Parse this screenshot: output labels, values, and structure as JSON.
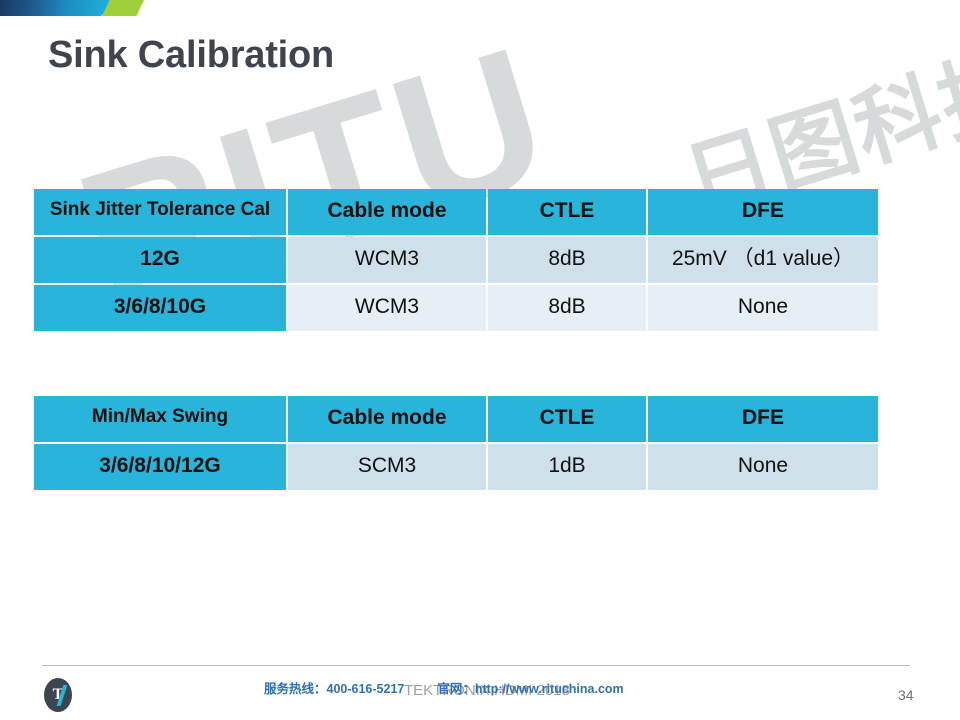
{
  "slide": {
    "title": "Sink Calibration",
    "page_number": "34"
  },
  "banner": {
    "blue_gradient_start": "#173a63",
    "blue_gradient_end": "#22b3df",
    "green_accent": "#9ece3a"
  },
  "watermark": {
    "latin": "RITU",
    "chinese": "日图科技",
    "color": "#c9ccce"
  },
  "colors": {
    "header_cyan": "#29b4d9",
    "cell_blue": "#cfe0ea",
    "cell_light": "#e6eff5",
    "title_gray": "#40454d",
    "footer_blue": "#2f6fb5"
  },
  "tables": [
    {
      "name": "sink-jitter-tolerance-cal",
      "headers": [
        "Sink Jitter Tolerance Cal",
        "Cable mode",
        "CTLE",
        "DFE"
      ],
      "rows": [
        [
          "12G",
          "WCM3",
          "8dB",
          "25mV （d1 value）"
        ],
        [
          "3/6/8/10G",
          "WCM3",
          "8dB",
          "None"
        ]
      ]
    },
    {
      "name": "min-max-swing",
      "headers": [
        "Min/Max Swing",
        "Cable mode",
        "CTLE",
        "DFE"
      ],
      "rows": [
        [
          "3/6/8/10/12G",
          "SCM3",
          "1dB",
          "None"
        ]
      ]
    }
  ],
  "footer": {
    "hotline_label": "服务热线：400-616-5217",
    "website_label": "官网：http://www.rituchina.com",
    "deck_title": "TEKTRONIX HDMI 2018",
    "logo_text": "T"
  }
}
